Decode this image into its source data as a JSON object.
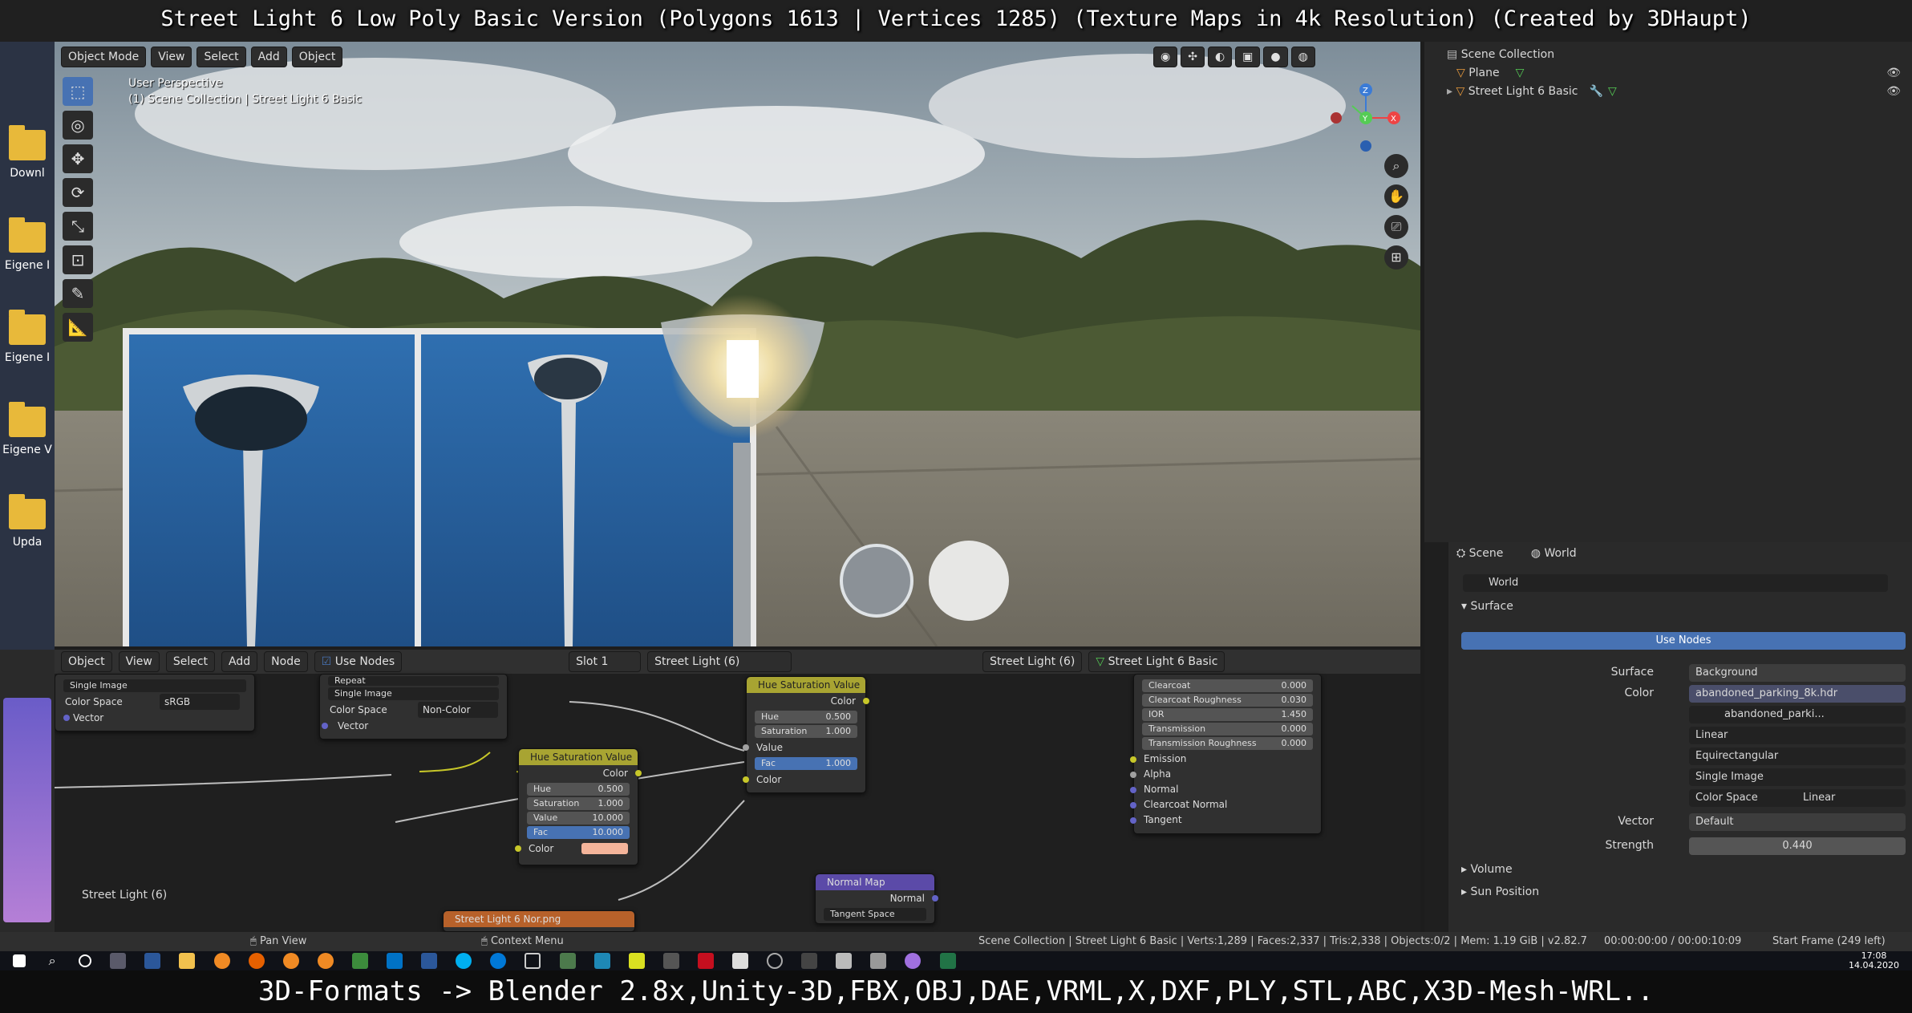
{
  "captions": {
    "top": "Street Light 6 Low Poly Basic Version (Polygons 1613 | Vertices 1285) (Texture Maps in 4k Resolution) (Created by 3DHaupt)",
    "bottom": "3D-Formats -> Blender 2.8x,Unity-3D,FBX,OBJ,DAE,VRML,X,DXF,PLY,STL,ABC,X3D-Mesh-WRL.."
  },
  "desktop": {
    "items": [
      "Downl",
      "Eigene I",
      "Eigene I",
      "Eigene V",
      "Upda"
    ]
  },
  "viewport": {
    "mode": "Object Mode",
    "menus": [
      "View",
      "Select",
      "Add",
      "Object"
    ],
    "overlay_line1": "User Perspective",
    "overlay_line2": "(1) Scene Collection | Street Light 6 Basic",
    "gizmo_axes": [
      "Z",
      "Y",
      "X"
    ]
  },
  "outliner": {
    "root": "Scene Collection",
    "items": [
      "Plane",
      "Street Light 6 Basic"
    ]
  },
  "properties": {
    "breadcrumb": [
      "Scene",
      "World"
    ],
    "world_name": "World",
    "surface_section": "Surface",
    "use_nodes_button": "Use Nodes",
    "surface_label": "Surface",
    "surface_value": "Background",
    "color_label": "Color",
    "color_value": "abandoned_parking_8k.hdr",
    "image_name": "abandoned_parki...",
    "interpolation": "Linear",
    "projection": "Equirectangular",
    "source": "Single Image",
    "color_space_label": "Color Space",
    "color_space_value": "Linear",
    "vector_label": "Vector",
    "vector_value": "Default",
    "strength_label": "Strength",
    "strength_value": "0.440",
    "volume_section": "Volume",
    "sun_section": "Sun Position"
  },
  "node_editor": {
    "editor_type": "Object",
    "menus": [
      "View",
      "Select",
      "Add",
      "Node"
    ],
    "use_nodes": "Use Nodes",
    "slot": "Slot 1",
    "material": "Street Light (6)",
    "breadcrumb_material": "Street Light (6)",
    "breadcrumb_object": "Street Light 6 Basic",
    "footer_label": "Street Light (6)",
    "node_a": {
      "interp": "Single Image",
      "cs_label": "Color Space",
      "cs_value": "sRGB",
      "vector": "Vector"
    },
    "node_b": {
      "repeat": "Repeat",
      "interp": "Single Image",
      "cs_label": "Color Space",
      "cs_value": "Non-Color",
      "vector": "Vector"
    },
    "hsv1": {
      "title": "Hue Saturation Value",
      "out": "Color",
      "hue": "Hue",
      "hue_v": "0.500",
      "sat": "Saturation",
      "sat_v": "1.000",
      "val": "Value",
      "val_v": "10.000",
      "fac": "Fac",
      "fac_v": "10.000",
      "color": "Color"
    },
    "hsv2": {
      "title": "Hue Saturation Value",
      "out": "Color",
      "hue": "Hue",
      "hue_v": "0.500",
      "sat": "Saturation",
      "sat_v": "1.000",
      "val": "Value",
      "fac": "Fac",
      "fac_v": "1.000",
      "color": "Color"
    },
    "bsdf": {
      "rows": [
        {
          "k": "Clearcoat",
          "v": "0.000"
        },
        {
          "k": "Clearcoat Roughness",
          "v": "0.030"
        },
        {
          "k": "IOR",
          "v": "1.450"
        },
        {
          "k": "Transmission",
          "v": "0.000"
        },
        {
          "k": "Transmission Roughness",
          "v": "0.000"
        }
      ],
      "inputs": [
        "Emission",
        "Alpha",
        "Normal",
        "Clearcoat Normal",
        "Tangent"
      ]
    },
    "normal_map": {
      "title": "Normal Map",
      "out": "Normal",
      "space": "Tangent Space"
    },
    "image_node": {
      "title": "Street Light 6 Nor.png"
    }
  },
  "statusbar": {
    "pan": "Pan View",
    "context": "Context Menu",
    "stats": "Scene Collection | Street Light 6 Basic | Verts:1,289 | Faces:2,337 | Tris:2,338 | Objects:0/2 | Mem: 1.19 GiB | v2.82.7",
    "time": "00:00:00:00 / 00:00:10:09",
    "frame": "Start Frame (249 left)"
  },
  "taskbar": {
    "clock": "17:08",
    "date": "14.04.2020"
  }
}
